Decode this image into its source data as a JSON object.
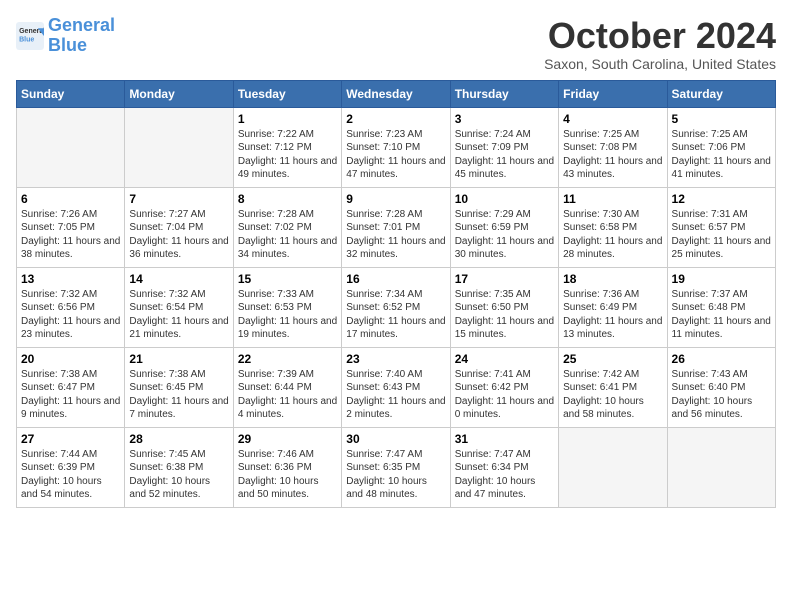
{
  "logo": {
    "line1": "General",
    "line2": "Blue"
  },
  "title": "October 2024",
  "subtitle": "Saxon, South Carolina, United States",
  "days_header": [
    "Sunday",
    "Monday",
    "Tuesday",
    "Wednesday",
    "Thursday",
    "Friday",
    "Saturday"
  ],
  "weeks": [
    [
      {
        "day": "",
        "empty": true
      },
      {
        "day": "",
        "empty": true
      },
      {
        "day": "1",
        "sunrise": "Sunrise: 7:22 AM",
        "sunset": "Sunset: 7:12 PM",
        "daylight": "Daylight: 11 hours and 49 minutes."
      },
      {
        "day": "2",
        "sunrise": "Sunrise: 7:23 AM",
        "sunset": "Sunset: 7:10 PM",
        "daylight": "Daylight: 11 hours and 47 minutes."
      },
      {
        "day": "3",
        "sunrise": "Sunrise: 7:24 AM",
        "sunset": "Sunset: 7:09 PM",
        "daylight": "Daylight: 11 hours and 45 minutes."
      },
      {
        "day": "4",
        "sunrise": "Sunrise: 7:25 AM",
        "sunset": "Sunset: 7:08 PM",
        "daylight": "Daylight: 11 hours and 43 minutes."
      },
      {
        "day": "5",
        "sunrise": "Sunrise: 7:25 AM",
        "sunset": "Sunset: 7:06 PM",
        "daylight": "Daylight: 11 hours and 41 minutes."
      }
    ],
    [
      {
        "day": "6",
        "sunrise": "Sunrise: 7:26 AM",
        "sunset": "Sunset: 7:05 PM",
        "daylight": "Daylight: 11 hours and 38 minutes."
      },
      {
        "day": "7",
        "sunrise": "Sunrise: 7:27 AM",
        "sunset": "Sunset: 7:04 PM",
        "daylight": "Daylight: 11 hours and 36 minutes."
      },
      {
        "day": "8",
        "sunrise": "Sunrise: 7:28 AM",
        "sunset": "Sunset: 7:02 PM",
        "daylight": "Daylight: 11 hours and 34 minutes."
      },
      {
        "day": "9",
        "sunrise": "Sunrise: 7:28 AM",
        "sunset": "Sunset: 7:01 PM",
        "daylight": "Daylight: 11 hours and 32 minutes."
      },
      {
        "day": "10",
        "sunrise": "Sunrise: 7:29 AM",
        "sunset": "Sunset: 6:59 PM",
        "daylight": "Daylight: 11 hours and 30 minutes."
      },
      {
        "day": "11",
        "sunrise": "Sunrise: 7:30 AM",
        "sunset": "Sunset: 6:58 PM",
        "daylight": "Daylight: 11 hours and 28 minutes."
      },
      {
        "day": "12",
        "sunrise": "Sunrise: 7:31 AM",
        "sunset": "Sunset: 6:57 PM",
        "daylight": "Daylight: 11 hours and 25 minutes."
      }
    ],
    [
      {
        "day": "13",
        "sunrise": "Sunrise: 7:32 AM",
        "sunset": "Sunset: 6:56 PM",
        "daylight": "Daylight: 11 hours and 23 minutes."
      },
      {
        "day": "14",
        "sunrise": "Sunrise: 7:32 AM",
        "sunset": "Sunset: 6:54 PM",
        "daylight": "Daylight: 11 hours and 21 minutes."
      },
      {
        "day": "15",
        "sunrise": "Sunrise: 7:33 AM",
        "sunset": "Sunset: 6:53 PM",
        "daylight": "Daylight: 11 hours and 19 minutes."
      },
      {
        "day": "16",
        "sunrise": "Sunrise: 7:34 AM",
        "sunset": "Sunset: 6:52 PM",
        "daylight": "Daylight: 11 hours and 17 minutes."
      },
      {
        "day": "17",
        "sunrise": "Sunrise: 7:35 AM",
        "sunset": "Sunset: 6:50 PM",
        "daylight": "Daylight: 11 hours and 15 minutes."
      },
      {
        "day": "18",
        "sunrise": "Sunrise: 7:36 AM",
        "sunset": "Sunset: 6:49 PM",
        "daylight": "Daylight: 11 hours and 13 minutes."
      },
      {
        "day": "19",
        "sunrise": "Sunrise: 7:37 AM",
        "sunset": "Sunset: 6:48 PM",
        "daylight": "Daylight: 11 hours and 11 minutes."
      }
    ],
    [
      {
        "day": "20",
        "sunrise": "Sunrise: 7:38 AM",
        "sunset": "Sunset: 6:47 PM",
        "daylight": "Daylight: 11 hours and 9 minutes."
      },
      {
        "day": "21",
        "sunrise": "Sunrise: 7:38 AM",
        "sunset": "Sunset: 6:45 PM",
        "daylight": "Daylight: 11 hours and 7 minutes."
      },
      {
        "day": "22",
        "sunrise": "Sunrise: 7:39 AM",
        "sunset": "Sunset: 6:44 PM",
        "daylight": "Daylight: 11 hours and 4 minutes."
      },
      {
        "day": "23",
        "sunrise": "Sunrise: 7:40 AM",
        "sunset": "Sunset: 6:43 PM",
        "daylight": "Daylight: 11 hours and 2 minutes."
      },
      {
        "day": "24",
        "sunrise": "Sunrise: 7:41 AM",
        "sunset": "Sunset: 6:42 PM",
        "daylight": "Daylight: 11 hours and 0 minutes."
      },
      {
        "day": "25",
        "sunrise": "Sunrise: 7:42 AM",
        "sunset": "Sunset: 6:41 PM",
        "daylight": "Daylight: 10 hours and 58 minutes."
      },
      {
        "day": "26",
        "sunrise": "Sunrise: 7:43 AM",
        "sunset": "Sunset: 6:40 PM",
        "daylight": "Daylight: 10 hours and 56 minutes."
      }
    ],
    [
      {
        "day": "27",
        "sunrise": "Sunrise: 7:44 AM",
        "sunset": "Sunset: 6:39 PM",
        "daylight": "Daylight: 10 hours and 54 minutes."
      },
      {
        "day": "28",
        "sunrise": "Sunrise: 7:45 AM",
        "sunset": "Sunset: 6:38 PM",
        "daylight": "Daylight: 10 hours and 52 minutes."
      },
      {
        "day": "29",
        "sunrise": "Sunrise: 7:46 AM",
        "sunset": "Sunset: 6:36 PM",
        "daylight": "Daylight: 10 hours and 50 minutes."
      },
      {
        "day": "30",
        "sunrise": "Sunrise: 7:47 AM",
        "sunset": "Sunset: 6:35 PM",
        "daylight": "Daylight: 10 hours and 48 minutes."
      },
      {
        "day": "31",
        "sunrise": "Sunrise: 7:47 AM",
        "sunset": "Sunset: 6:34 PM",
        "daylight": "Daylight: 10 hours and 47 minutes."
      },
      {
        "day": "",
        "empty": true
      },
      {
        "day": "",
        "empty": true
      }
    ]
  ]
}
